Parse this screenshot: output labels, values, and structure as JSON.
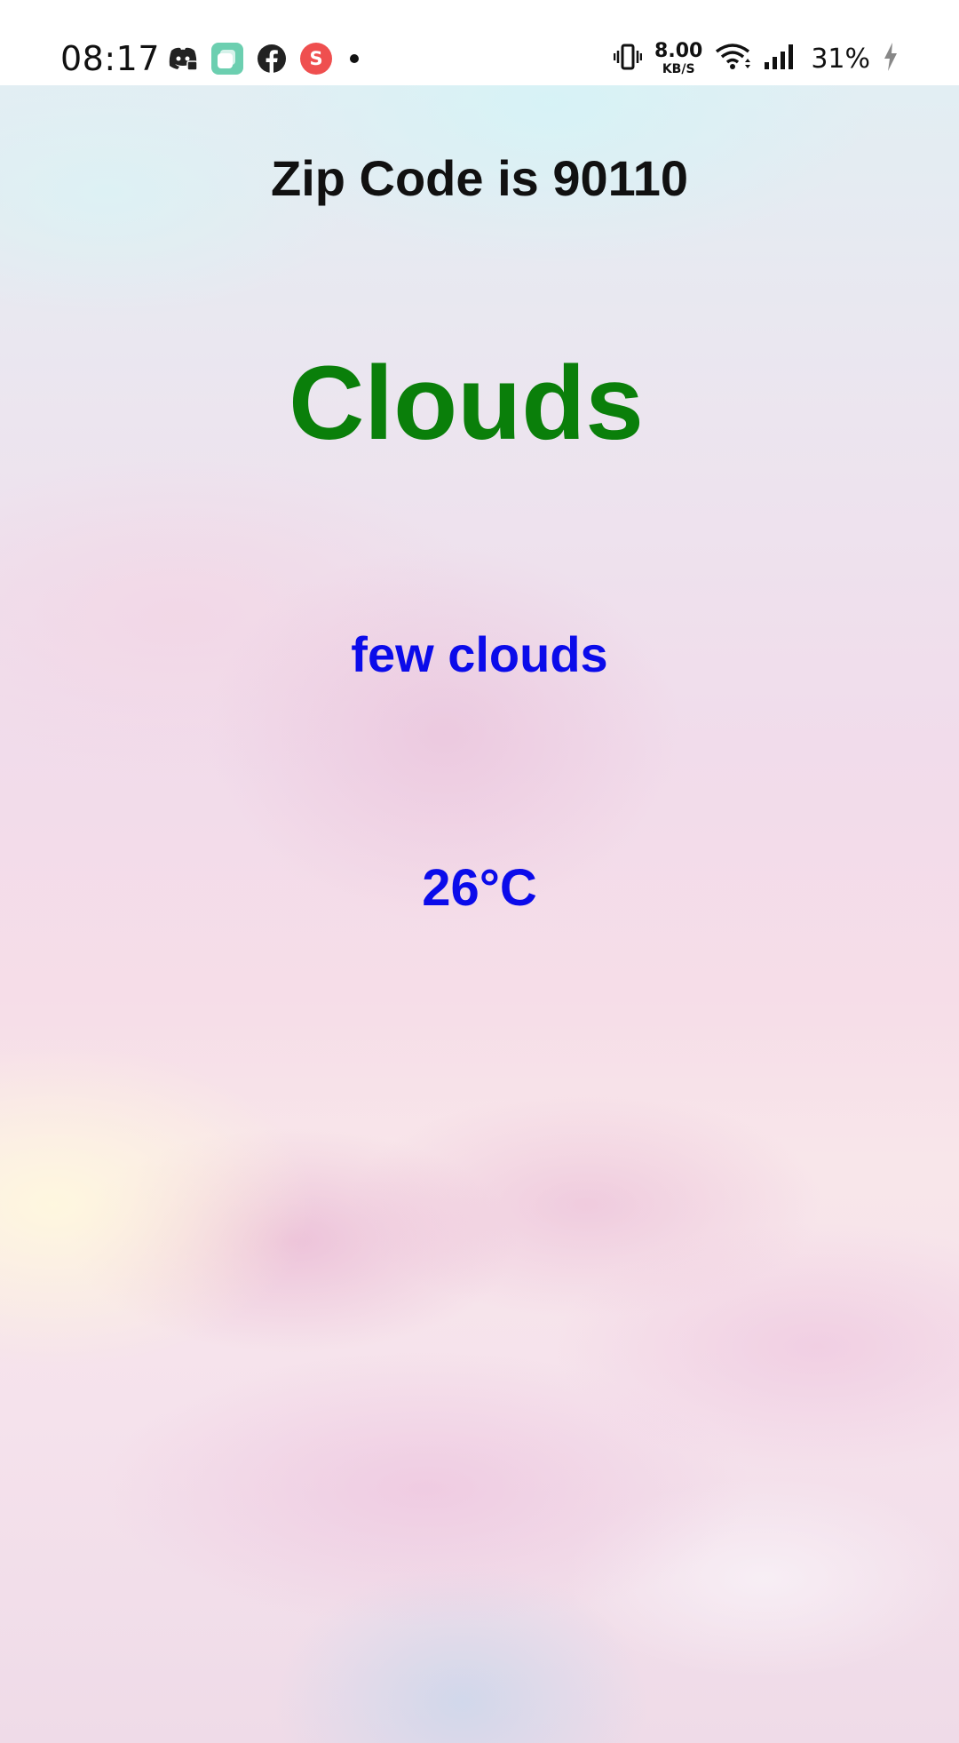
{
  "status_bar": {
    "time": "08:17",
    "notification_icons": [
      "discord-icon",
      "app-square-icon",
      "facebook-icon",
      "s-app-icon",
      "more-dot-icon"
    ],
    "net_speed_value": "8.00",
    "net_speed_unit": "KB/S",
    "battery_percent": "31%",
    "system_icons": [
      "vibrate-icon",
      "wifi-icon",
      "signal-icon",
      "charging-icon"
    ]
  },
  "weather": {
    "zip_label": "Zip Code is 90110",
    "condition": "Clouds",
    "description": "few clouds",
    "temperature": "26°C"
  },
  "colors": {
    "condition_text": "#0a7f0a",
    "detail_text": "#0b0bea",
    "title_text": "#111111"
  }
}
